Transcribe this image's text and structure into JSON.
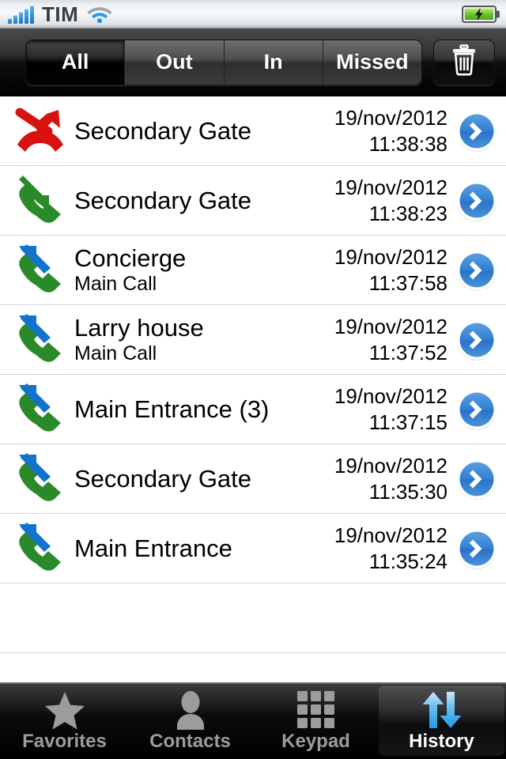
{
  "statusbar": {
    "carrier": "TIM",
    "signal_bars": 5,
    "signal_icon": "signal-bars-icon",
    "wifi_icon": "wifi-icon",
    "battery_icon": "battery-charging-icon",
    "battery_state": "charging",
    "battery_color": "#67c227"
  },
  "toolbar": {
    "filters": [
      {
        "label": "All",
        "selected": true
      },
      {
        "label": "Out",
        "selected": false
      },
      {
        "label": "In",
        "selected": false
      },
      {
        "label": "Missed",
        "selected": false
      }
    ],
    "delete_icon": "trash-icon",
    "delete_label": "Delete"
  },
  "list": {
    "rows": [
      {
        "title": "Secondary Gate",
        "subtitle": "",
        "date": "19/nov/2012",
        "time": "11:38:38",
        "call_type": "missed",
        "icon": "missed-call-icon",
        "accessory_icon": "disclosure-chevron-icon"
      },
      {
        "title": "Secondary Gate",
        "subtitle": "",
        "date": "19/nov/2012",
        "time": "11:38:23",
        "call_type": "incoming",
        "icon": "incoming-call-icon",
        "accessory_icon": "disclosure-chevron-icon"
      },
      {
        "title": "Concierge",
        "subtitle": "Main Call",
        "date": "19/nov/2012",
        "time": "11:37:58",
        "call_type": "outgoing",
        "icon": "outgoing-call-icon",
        "accessory_icon": "disclosure-chevron-icon"
      },
      {
        "title": "Larry house",
        "subtitle": "Main Call",
        "date": "19/nov/2012",
        "time": "11:37:52",
        "call_type": "outgoing",
        "icon": "outgoing-call-icon",
        "accessory_icon": "disclosure-chevron-icon"
      },
      {
        "title": "Main Entrance (3)",
        "subtitle": "",
        "date": "19/nov/2012",
        "time": "11:37:15",
        "call_type": "outgoing",
        "icon": "outgoing-call-icon",
        "accessory_icon": "disclosure-chevron-icon"
      },
      {
        "title": "Secondary Gate",
        "subtitle": "",
        "date": "19/nov/2012",
        "time": "11:35:30",
        "call_type": "outgoing",
        "icon": "outgoing-call-icon",
        "accessory_icon": "disclosure-chevron-icon"
      },
      {
        "title": "Main Entrance",
        "subtitle": "",
        "date": "19/nov/2012",
        "time": "11:35:24",
        "call_type": "outgoing",
        "icon": "outgoing-call-icon",
        "accessory_icon": "disclosure-chevron-icon"
      }
    ],
    "empty_rows": 1,
    "colors": {
      "missed": "#d81111",
      "incoming": "#2a8a2a",
      "outgoing_handset": "#2a8a2a",
      "outgoing_arrow": "#1273cd",
      "accessory": "#2f7fd4"
    }
  },
  "tabbar": {
    "tabs": [
      {
        "label": "Favorites",
        "icon": "star-icon",
        "selected": false
      },
      {
        "label": "Contacts",
        "icon": "person-icon",
        "selected": false
      },
      {
        "label": "Keypad",
        "icon": "keypad-grid-icon",
        "selected": false
      },
      {
        "label": "History",
        "icon": "history-arrows-icon",
        "selected": true
      }
    ]
  }
}
